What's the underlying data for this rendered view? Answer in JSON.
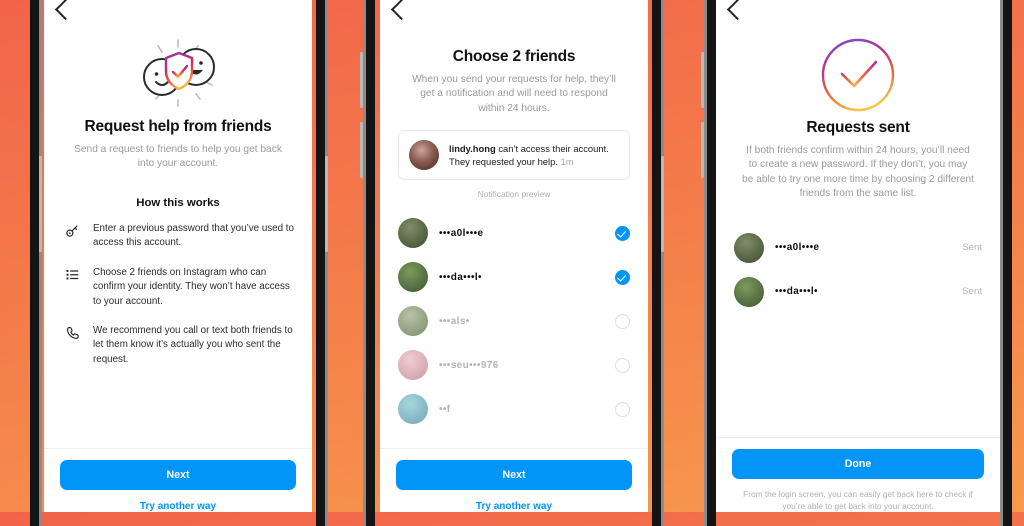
{
  "theme": {
    "background_gradient_from": "#f2644a",
    "background_gradient_to": "#f79a4e",
    "accent_blue": "#0095f6",
    "text_primary": "#111111",
    "text_muted": "#9a9a9a"
  },
  "panels": [
    {
      "id": "request-help",
      "back_icon": "back-chevron-icon",
      "hero_icon": "friends-shield-check-illustration",
      "title": "Request help from friends",
      "subtitle": "Send a request to friends to help you get back into your account.",
      "section_heading": "How this works",
      "steps": [
        {
          "icon": "key-icon",
          "text": "Enter a previous password that you’ve used to access this account."
        },
        {
          "icon": "list-icon",
          "text": "Choose 2 friends on Instagram who can confirm your identity. They won’t have access to your account."
        },
        {
          "icon": "phone-icon",
          "text": "We recommend you call or text both friends to let them know it’s actually you who sent the request."
        }
      ],
      "primary_button": "Next",
      "secondary_link": "Try another way"
    },
    {
      "id": "choose-friends",
      "back_icon": "back-chevron-icon",
      "title": "Choose 2 friends",
      "subtitle": "When you send your requests for help, they’ll get a notification and will need to respond within 24 hours.",
      "notification": {
        "avatar": "lindy-hong-avatar",
        "username": "lindy.hong",
        "message": "can’t access their account. They requested your help.",
        "time": "1m"
      },
      "notification_caption": "Notification preview",
      "friends": [
        {
          "name": "•••a0l•••e",
          "selected": true,
          "avatar_color_a": "#7f8d64",
          "avatar_color_b": "#3f4a33"
        },
        {
          "name": "•••da•••l•",
          "selected": true,
          "avatar_color_a": "#7d9a5c",
          "avatar_color_b": "#3c5530"
        },
        {
          "name": "•••als•",
          "selected": false,
          "avatar_color_a": "#b7c3a4",
          "avatar_color_b": "#7d8a6c"
        },
        {
          "name": "•••seu•••976",
          "selected": false,
          "avatar_color_a": "#f0cdd2",
          "avatar_color_b": "#c99aa4"
        },
        {
          "name": "••f",
          "selected": false,
          "avatar_color_a": "#a9d6de",
          "avatar_color_b": "#6fa7b6"
        }
      ],
      "primary_button": "Next",
      "secondary_link": "Try another way"
    },
    {
      "id": "requests-sent",
      "back_icon": "back-chevron-icon",
      "hero_icon": "gradient-check-circle-icon",
      "title": "Requests sent",
      "subtitle": "If both friends confirm within 24 hours, you’ll need to create a new password. If they don’t, you may be able to try one more time by choosing 2 different friends from the same list.",
      "recipients": [
        {
          "name": "•••a0l•••e",
          "status": "Sent",
          "avatar_color_a": "#7f8d64",
          "avatar_color_b": "#3f4a33"
        },
        {
          "name": "•••da•••l•",
          "status": "Sent",
          "avatar_color_a": "#7d9a5c",
          "avatar_color_b": "#3c5530"
        }
      ],
      "primary_button": "Done",
      "fine_print": "From the login screen, you can easily get back here to check if you’re able to get back into your account."
    }
  ]
}
